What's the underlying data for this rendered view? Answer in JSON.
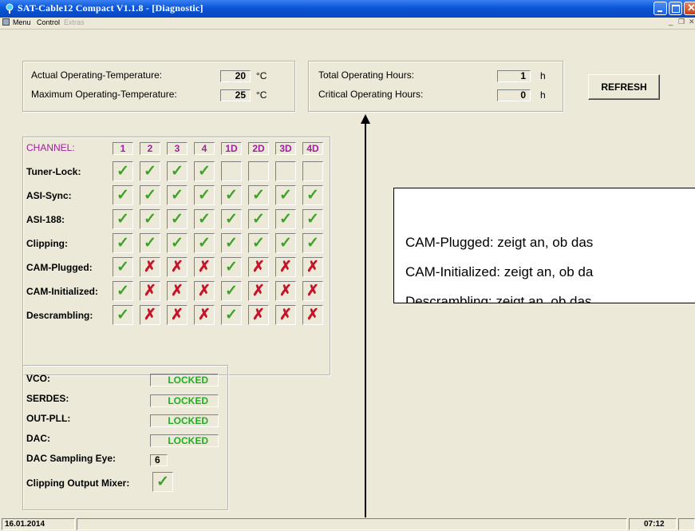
{
  "window": {
    "title": "SAT-Cable12 Compact V1.1.8 - [Diagnostic]"
  },
  "menu": {
    "items": [
      "Menu",
      "Control",
      "Extras"
    ]
  },
  "temperature": {
    "actual_label": "Actual Operating-Temperature:",
    "actual_value": "20",
    "max_label": "Maximum Operating-Temperature:",
    "max_value": "25",
    "unit": "°C"
  },
  "hours": {
    "total_label": "Total Operating Hours:",
    "total_value": "1",
    "critical_label": "Critical Operating Hours:",
    "critical_value": "0",
    "unit": "h"
  },
  "refresh_button": "REFRESH",
  "channel_grid": {
    "header_label": "CHANNEL:",
    "channels": [
      "1",
      "2",
      "3",
      "4",
      "1D",
      "2D",
      "3D",
      "4D"
    ],
    "rows": [
      {
        "label": "Tuner-Lock:",
        "states": [
          "check",
          "check",
          "check",
          "check",
          "empty",
          "empty",
          "empty",
          "empty"
        ]
      },
      {
        "label": "ASI-Sync:",
        "states": [
          "check",
          "check",
          "check",
          "check",
          "check",
          "check",
          "check",
          "check"
        ]
      },
      {
        "label": "ASI-188:",
        "states": [
          "check",
          "check",
          "check",
          "check",
          "check",
          "check",
          "check",
          "check"
        ]
      },
      {
        "label": "Clipping:",
        "states": [
          "check",
          "check",
          "check",
          "check",
          "check",
          "check",
          "check",
          "check"
        ]
      },
      {
        "label": "CAM-Plugged:",
        "states": [
          "check",
          "cross",
          "cross",
          "cross",
          "check",
          "cross",
          "cross",
          "cross"
        ]
      },
      {
        "label": "CAM-Initialized:",
        "states": [
          "check",
          "cross",
          "cross",
          "cross",
          "check",
          "cross",
          "cross",
          "cross"
        ]
      },
      {
        "label": "Descrambling:",
        "states": [
          "check",
          "cross",
          "cross",
          "cross",
          "check",
          "cross",
          "cross",
          "cross"
        ]
      }
    ]
  },
  "pll": {
    "vco_label": "VCO:",
    "vco_value": "LOCKED",
    "serdes_label": "SERDES:",
    "serdes_value": "LOCKED",
    "outpll_label": "OUT-PLL:",
    "outpll_value": "LOCKED",
    "dac_label": "DAC:",
    "dac_value": "LOCKED",
    "eye_label": "DAC Sampling Eye:",
    "eye_value": "6",
    "clip_label": "Clipping Output Mixer:"
  },
  "overlay": {
    "line1": "CAM-Plugged: zeigt an, ob das",
    "line2": "CAM-Initialized: zeigt an, ob da",
    "line3": "Descrambling: zeigt an, ob das"
  },
  "status": {
    "date": "16.01.2014",
    "time": "07:12"
  },
  "colors": {
    "check": "#3fa02a",
    "cross": "#c8142a",
    "locked": "#20b020",
    "channel": "#a020a0",
    "titlebar": "#0a56d8"
  }
}
